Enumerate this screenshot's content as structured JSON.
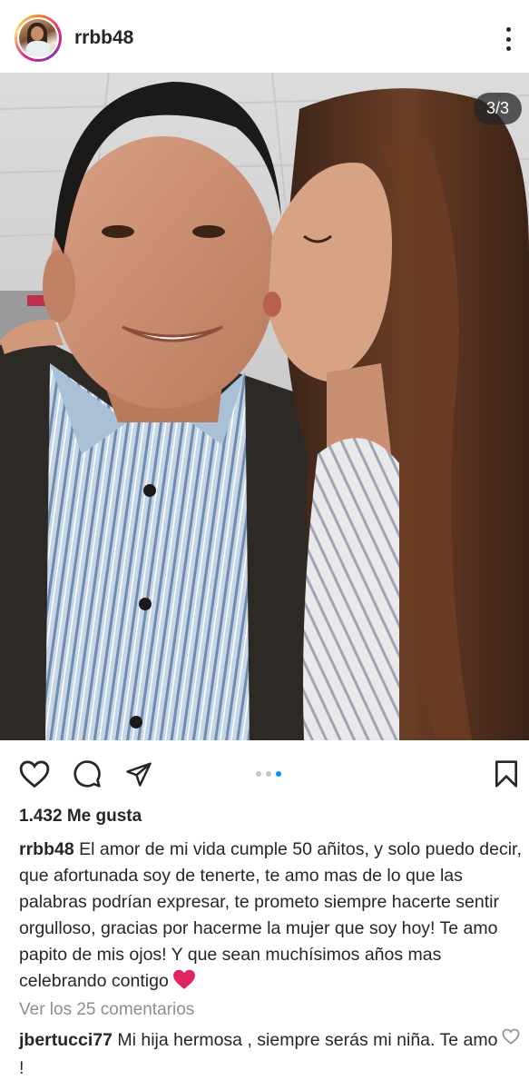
{
  "header": {
    "username": "rrbb48",
    "avatar_icon": "profile-photo",
    "more_icon": "more-vertical-icon"
  },
  "post": {
    "image_counter": "3/3",
    "carousel": {
      "total": 3,
      "active": 3
    }
  },
  "actions": {
    "like_icon": "heart-outline-icon",
    "comment_icon": "comment-bubble-icon",
    "share_icon": "paper-plane-icon",
    "save_icon": "bookmark-outline-icon"
  },
  "likes": "1.432 Me gusta",
  "caption": {
    "username": "rrbb48",
    "text": "El amor de mi vida cumple 50 añitos, y solo puedo decir, que afortunada soy de tenerte, te amo mas de lo que las palabras podrían expresar, te prometo siempre hacerte sentir orgulloso, gracias por hacerme la mujer que soy hoy! Te amo papito de mis ojos! Y que sean muchísimos años mas celebrando contigo"
  },
  "view_comments": "Ver los 25 comentarios",
  "comments": [
    {
      "username": "jbertucci77",
      "text": "Mi hija hermosa , siempre serás mi niña. Te amo !"
    }
  ],
  "colors": {
    "text": "#262626",
    "muted": "#8e8e8e",
    "accent": "#0095f6",
    "heart_emoji": "#e0245e"
  }
}
